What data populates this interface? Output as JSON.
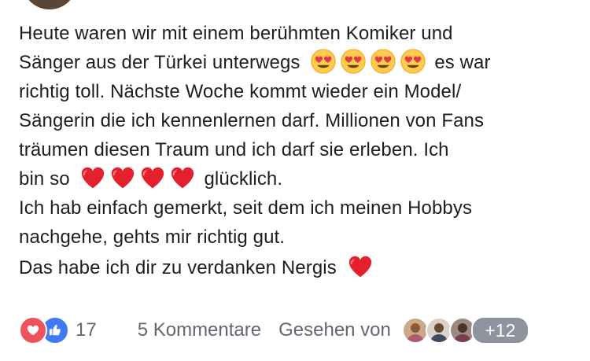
{
  "post": {
    "line1": "Heute waren wir mit einem berühmten Komiker und",
    "line2a": "Sänger aus der Türkei unterwegs",
    "line2b": "es war",
    "line3": "richtig toll. Nächste Woche kommt wieder ein Model/",
    "line4": "Sängerin die ich kennenlernen darf. Millionen von Fans",
    "line5": "träumen diesen Traum und ich darf sie erleben. Ich",
    "line6a": "bin so",
    "line6b": "glücklich.",
    "line7": "Ich hab einfach gemerkt, seit dem ich meinen Hobbys",
    "line8": "nachgehe, gehts mir richtig gut.",
    "line9": "Das habe ich dir zu verdanken Nergis",
    "emoji_group1": [
      "heart-eyes-emoji",
      "heart-eyes-emoji",
      "heart-eyes-emoji",
      "heart-eyes-emoji"
    ],
    "emoji_group2": [
      "red-heart-emoji",
      "red-heart-emoji",
      "red-heart-emoji",
      "red-heart-emoji"
    ],
    "emoji_final": "red-heart-emoji"
  },
  "footer": {
    "reaction_icons": [
      "love-reaction-icon",
      "like-reaction-icon"
    ],
    "reaction_count": "17",
    "comments_label": "5 Kommentare",
    "seen_label": "Gesehen von",
    "more_viewers": "+12"
  },
  "colors": {
    "text": "#1c1e21",
    "meta_text": "#606770",
    "love": "#f0525c",
    "like": "#3f79f3",
    "badge": "#8d949e"
  }
}
